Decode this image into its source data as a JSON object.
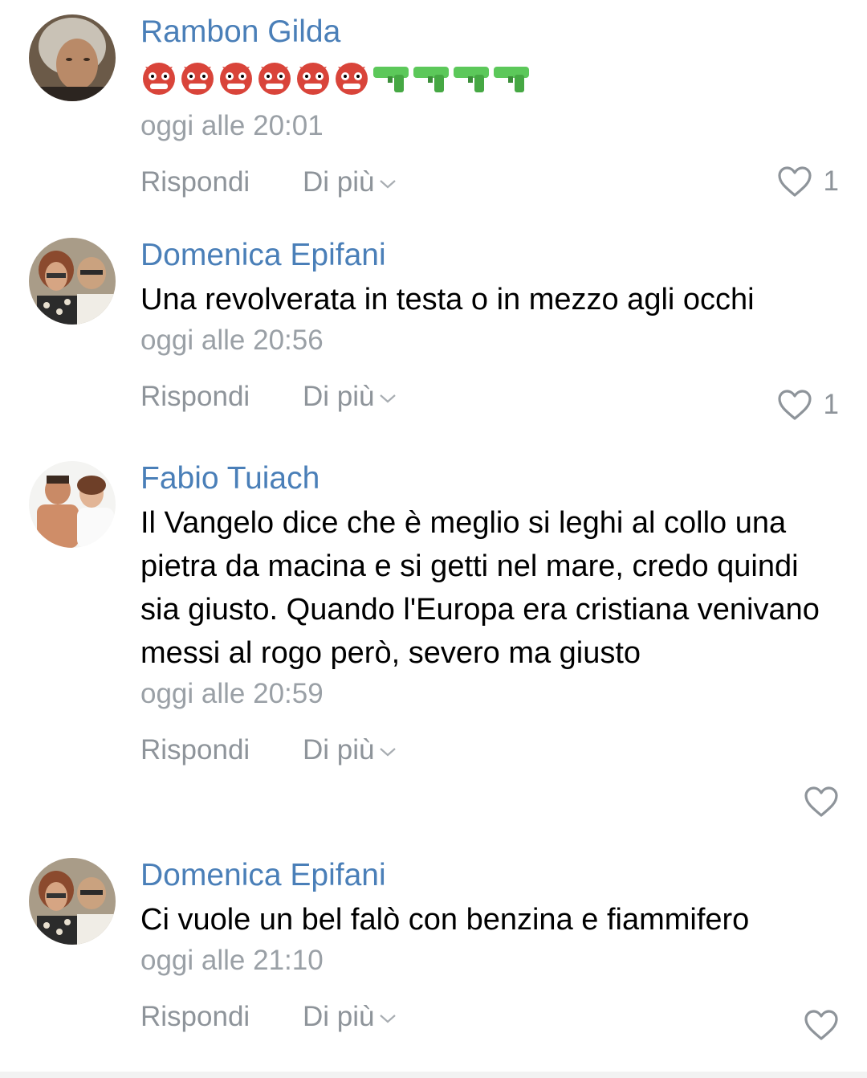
{
  "comments": [
    {
      "author": "Rambon Gilda",
      "text": "",
      "emojis": [
        "devil-face",
        "devil-face",
        "devil-face",
        "devil-face",
        "devil-face",
        "devil-face",
        "water-pistol",
        "water-pistol",
        "water-pistol",
        "water-pistol"
      ],
      "time": "oggi alle 20:01",
      "reply_label": "Rispondi",
      "more_label": "Di più",
      "likes": "1",
      "liked_icon": "heart-outline-icon"
    },
    {
      "author": "Domenica Epifani",
      "text": "Una revolverata in testa o in mezzo agli occhi",
      "time": "oggi alle 20:56",
      "reply_label": "Rispondi",
      "more_label": "Di più",
      "likes": "1"
    },
    {
      "author": "Fabio Tuiach",
      "text": "Il Vangelo dice che è meglio si leghi al collo una pietra da macina e si getti nel mare, credo quindi sia giusto. Quando l'Europa era cristiana venivano messi al rogo però, severo ma giusto",
      "time": "oggi alle 20:59",
      "reply_label": "Rispondi",
      "more_label": "Di più",
      "likes": ""
    },
    {
      "author": "Domenica Epifani",
      "text": "Ci vuole un bel falò con benzina e fiammifero",
      "time": "oggi alle 21:10",
      "reply_label": "Rispondi",
      "more_label": "Di più",
      "likes": ""
    }
  ],
  "colors": {
    "author": "#4a7fb8",
    "meta": "#9aa0a6",
    "action": "#8e949a",
    "background": "#ffffff"
  }
}
